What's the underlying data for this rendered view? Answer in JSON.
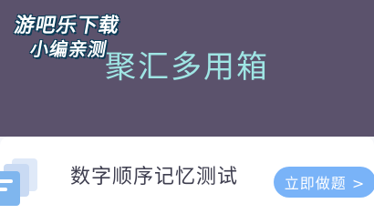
{
  "watermark": {
    "line1": "游吧乐下载",
    "line2": "小编亲测"
  },
  "app": {
    "title": "聚汇多用箱"
  },
  "card": {
    "title": "数字顺序记忆测试",
    "action_label": "立即做题 >"
  },
  "colors": {
    "header_bg": "#5b526c",
    "title_color": "#9fe5e4",
    "button_bg": "#79b3f8",
    "icon_front": "#7fb6ee",
    "icon_back": "#dfe9f8"
  }
}
